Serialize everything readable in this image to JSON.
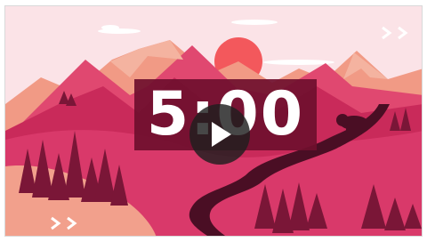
{
  "video": {
    "timer": "5:00",
    "colors": {
      "sky": "#fbe3e7",
      "sun": "#f3585c",
      "mountain_light": "#f19a85",
      "mountain_mid": "#e04870",
      "mountain_dark": "#c92a5a",
      "valley": "#d9396a",
      "pine": "#7a1637",
      "path": "#4a0e24",
      "timer_box": "#6f0f2e",
      "play_button": "#1e1e1e"
    },
    "icons": {
      "play": "play-icon",
      "arrows_top_right": "double-chevron-right-icon",
      "arrows_bottom_left": "double-chevron-right-icon",
      "animal": "bison-icon"
    }
  }
}
